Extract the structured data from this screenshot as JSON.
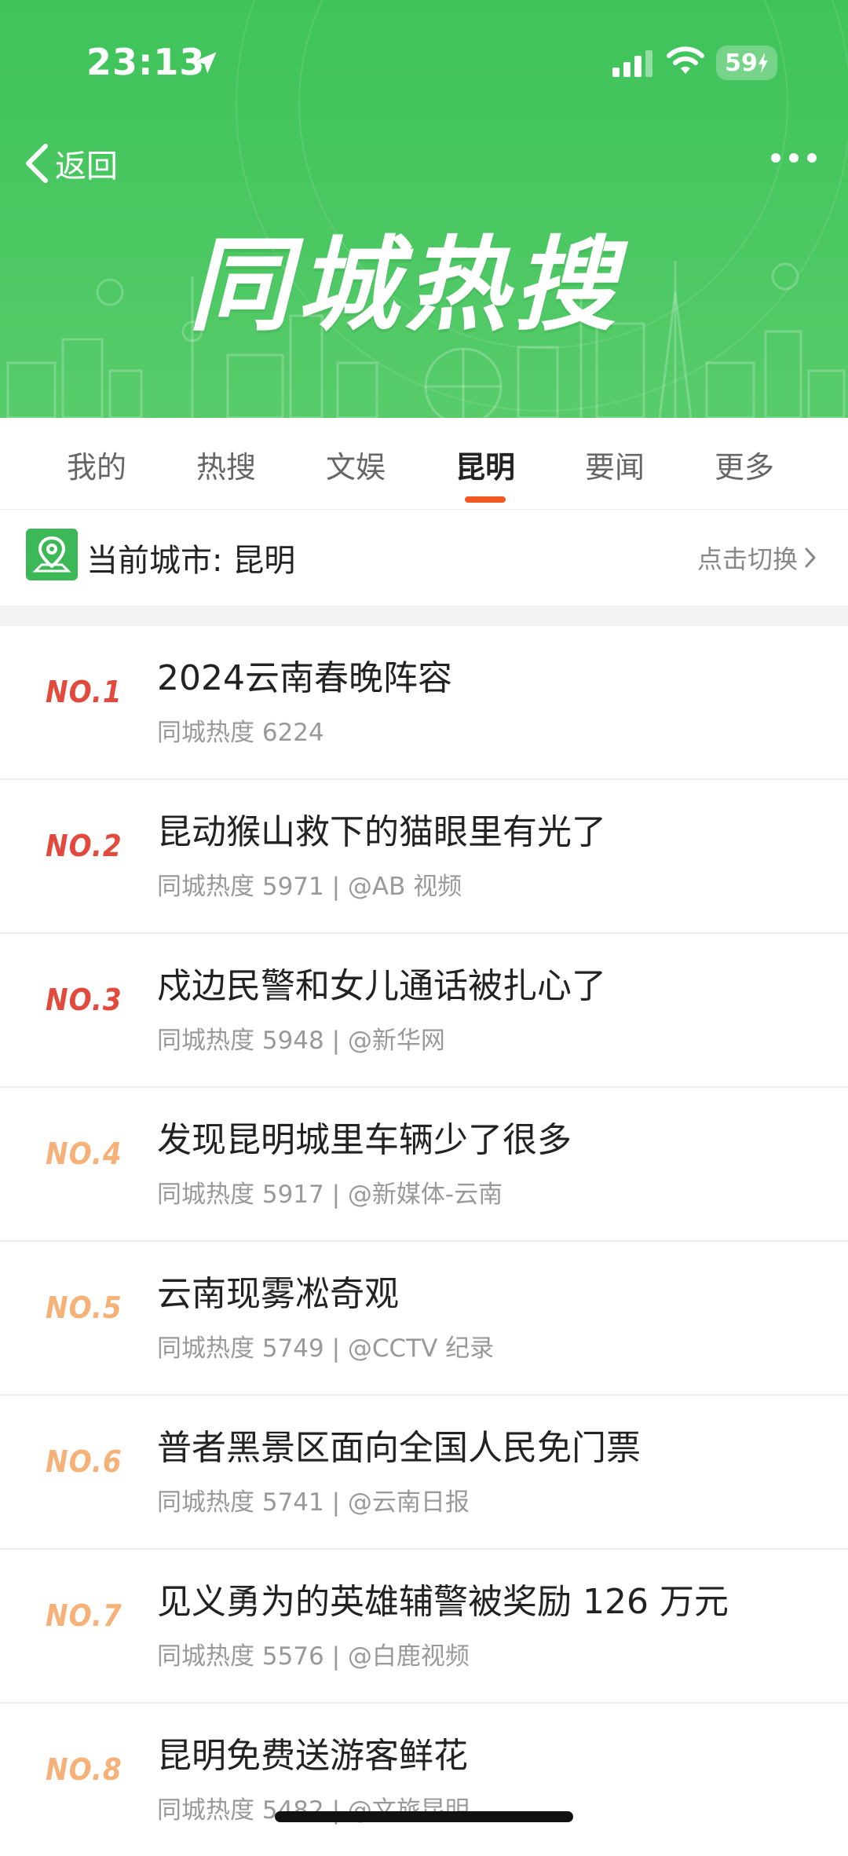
{
  "status_bar": {
    "time": "23:13",
    "battery": "59"
  },
  "header": {
    "back_label": "返回",
    "title": "同城热搜",
    "accent_color": "#43c55c"
  },
  "tabs": [
    {
      "label": "我的",
      "active": false
    },
    {
      "label": "热搜",
      "active": false
    },
    {
      "label": "文娱",
      "active": false
    },
    {
      "label": "昆明",
      "active": true
    },
    {
      "label": "要闻",
      "active": false
    },
    {
      "label": "更多",
      "active": false
    }
  ],
  "city_bar": {
    "label": "当前城市: 昆明",
    "switch_label": "点击切换"
  },
  "list": [
    {
      "rank": "NO.1",
      "title": "2024云南春晚阵容",
      "meta": "同城热度 6224"
    },
    {
      "rank": "NO.2",
      "title": "昆动猴山救下的猫眼里有光了",
      "meta": "同城热度 5971 | @AB 视频"
    },
    {
      "rank": "NO.3",
      "title": "戍边民警和女儿通话被扎心了",
      "meta": "同城热度 5948 | @新华网"
    },
    {
      "rank": "NO.4",
      "title": "发现昆明城里车辆少了很多",
      "meta": "同城热度 5917 | @新媒体-云南"
    },
    {
      "rank": "NO.5",
      "title": "云南现雾凇奇观",
      "meta": "同城热度 5749 | @CCTV 纪录"
    },
    {
      "rank": "NO.6",
      "title": "普者黑景区面向全国人民免门票",
      "meta": "同城热度 5741 | @云南日报"
    },
    {
      "rank": "NO.7",
      "title": "见义勇为的英雄辅警被奖励 126 万元",
      "meta": "同城热度 5576 | @白鹿视频"
    },
    {
      "rank": "NO.8",
      "title": "昆明免费送游客鲜花",
      "meta": "同城热度 5482 | @文旅昆明"
    }
  ]
}
